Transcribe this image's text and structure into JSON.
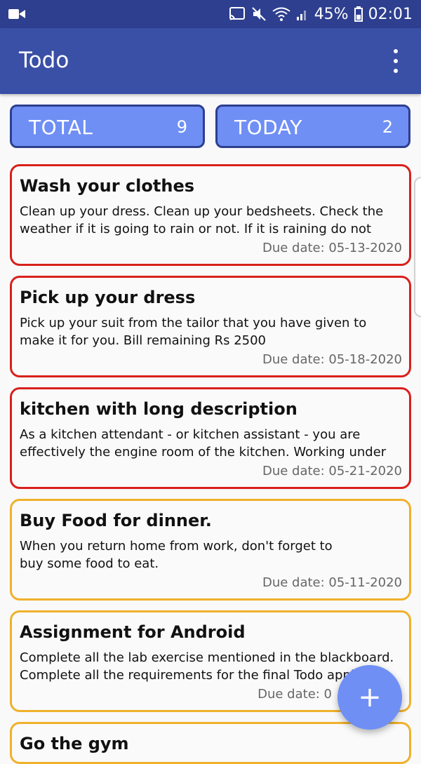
{
  "status_bar": {
    "battery": "45%",
    "time": "02:01"
  },
  "app_bar": {
    "title": "Todo"
  },
  "counters": {
    "total": {
      "label": "TOTAL",
      "value": "9"
    },
    "today": {
      "label": "TODAY",
      "value": "2"
    }
  },
  "todos": [
    {
      "title": "Wash your clothes",
      "description": "Clean up your dress. Clean up your bedsheets. Check the weather if it is going to rain or not. If it is raining do not wa...",
      "due": "Due date: 05-13-2020",
      "priority": "high"
    },
    {
      "title": "Pick up your dress",
      "description": "Pick up your suit from the tailor that you have given to make it for you. Bill remaining Rs 2500",
      "due": "Due date: 05-18-2020",
      "priority": "high"
    },
    {
      "title": "kitchen with long description",
      "description": "As a kitchen attendant - or kitchen assistant - you are effectively the engine room of the kitchen. Working under t...",
      "due": "Due date: 05-21-2020",
      "priority": "high"
    },
    {
      "title": "Buy Food for dinner.",
      "description": "When you return home from work, don't forget to buy some food to eat.",
      "due": "Due date: 05-11-2020",
      "priority": "medium"
    },
    {
      "title": "Assignment for Android",
      "description": "Complete all the lab exercise mentioned in the blackboard. Complete all the requirements for the final Todo appl",
      "due": "Due date: 0",
      "priority": "medium"
    },
    {
      "title": "Go the gym",
      "description": "",
      "due": "",
      "priority": "medium"
    }
  ],
  "fab": {
    "icon": "plus-icon",
    "label": "+"
  },
  "colors": {
    "status_bar": "#2e3f8f",
    "app_bar": "#3a4fa6",
    "counter_fill": "#6f8ff5",
    "high_priority_border": "#d9201c",
    "medium_priority_border": "#f0b12a"
  }
}
